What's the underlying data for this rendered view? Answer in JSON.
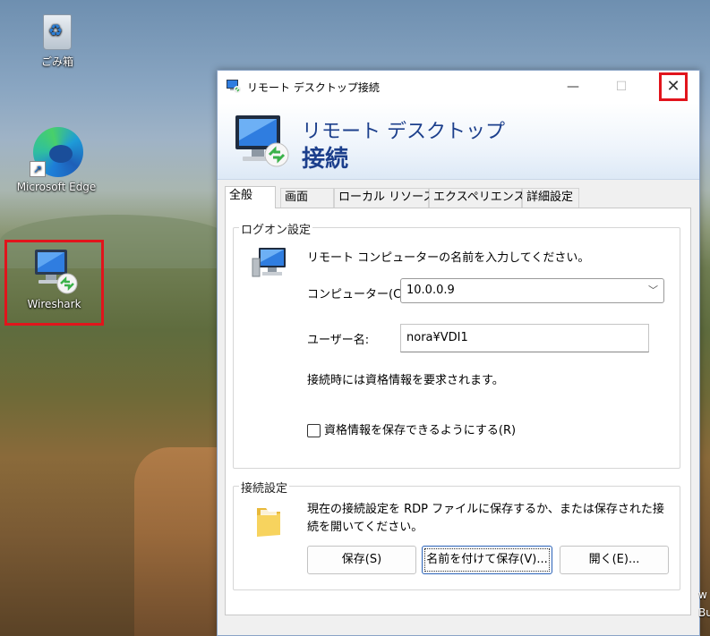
{
  "desktop": {
    "icons": [
      {
        "label": "ごみ箱",
        "icon": "recycle-bin-icon"
      },
      {
        "label": "Microsoft Edge",
        "icon": "edge-icon"
      },
      {
        "label": "Wireshark",
        "icon": "remote-desktop-icon"
      }
    ],
    "edge_text": "w\nBu"
  },
  "window": {
    "title": "リモート デスクトップ接続",
    "min_glyph": "—",
    "max_glyph": "☐",
    "close_glyph": "✕",
    "banner": {
      "line1": "リモート デスクトップ",
      "line2": "接続"
    },
    "tabs": [
      "全般",
      "画面",
      "ローカル リソース",
      "エクスペリエンス",
      "詳細設定"
    ],
    "logon": {
      "group_title": "ログオン設定",
      "prompt": "リモート コンピューターの名前を入力してください。",
      "computer_label": "コンピューター(C):",
      "computer_value": "10.0.0.9",
      "user_label": "ユーザー名:",
      "user_value": "nora¥VDI1",
      "info": "接続時には資格情報を要求されます。",
      "save_credentials_label": "資格情報を保存できるようにする(R)"
    },
    "connection": {
      "group_title": "接続設定",
      "desc": "現在の接続設定を RDP ファイルに保存するか、または保存された接続を開いてください。",
      "save_label": "保存(S)",
      "save_as_label": "名前を付けて保存(V)...",
      "open_label": "開く(E)..."
    }
  },
  "colors": {
    "highlight": "#e1141c",
    "banner_text": "#1c3f8c"
  }
}
